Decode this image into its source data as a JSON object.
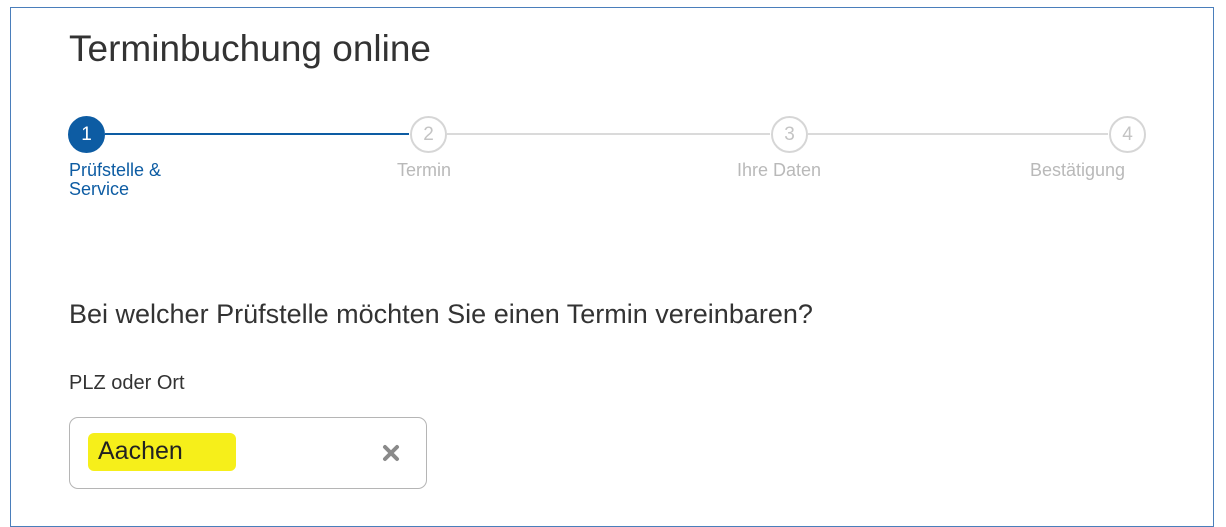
{
  "page": {
    "title": "Terminbuchung online"
  },
  "stepper": {
    "steps": [
      {
        "number": "1",
        "label_line1": "Prüfstelle &",
        "label_line2": "Service",
        "state": "active"
      },
      {
        "number": "2",
        "label_line1": "Termin",
        "label_line2": "",
        "state": "inactive"
      },
      {
        "number": "3",
        "label_line1": "Ihre Daten",
        "label_line2": "",
        "state": "inactive"
      },
      {
        "number": "4",
        "label_line1": "Bestätigung",
        "label_line2": "",
        "state": "inactive"
      }
    ]
  },
  "form": {
    "question": "Bei welcher Prüfstelle möchten Sie einen Termin vereinbaren?",
    "location_label": "PLZ oder Ort",
    "location_value": "Aachen",
    "clear_icon": "close-icon"
  },
  "colors": {
    "accent": "#0d5ca3",
    "inactive_step": "#b9b9b9",
    "highlight": "#f6ef1a",
    "frame_border": "#4a7ebb"
  }
}
